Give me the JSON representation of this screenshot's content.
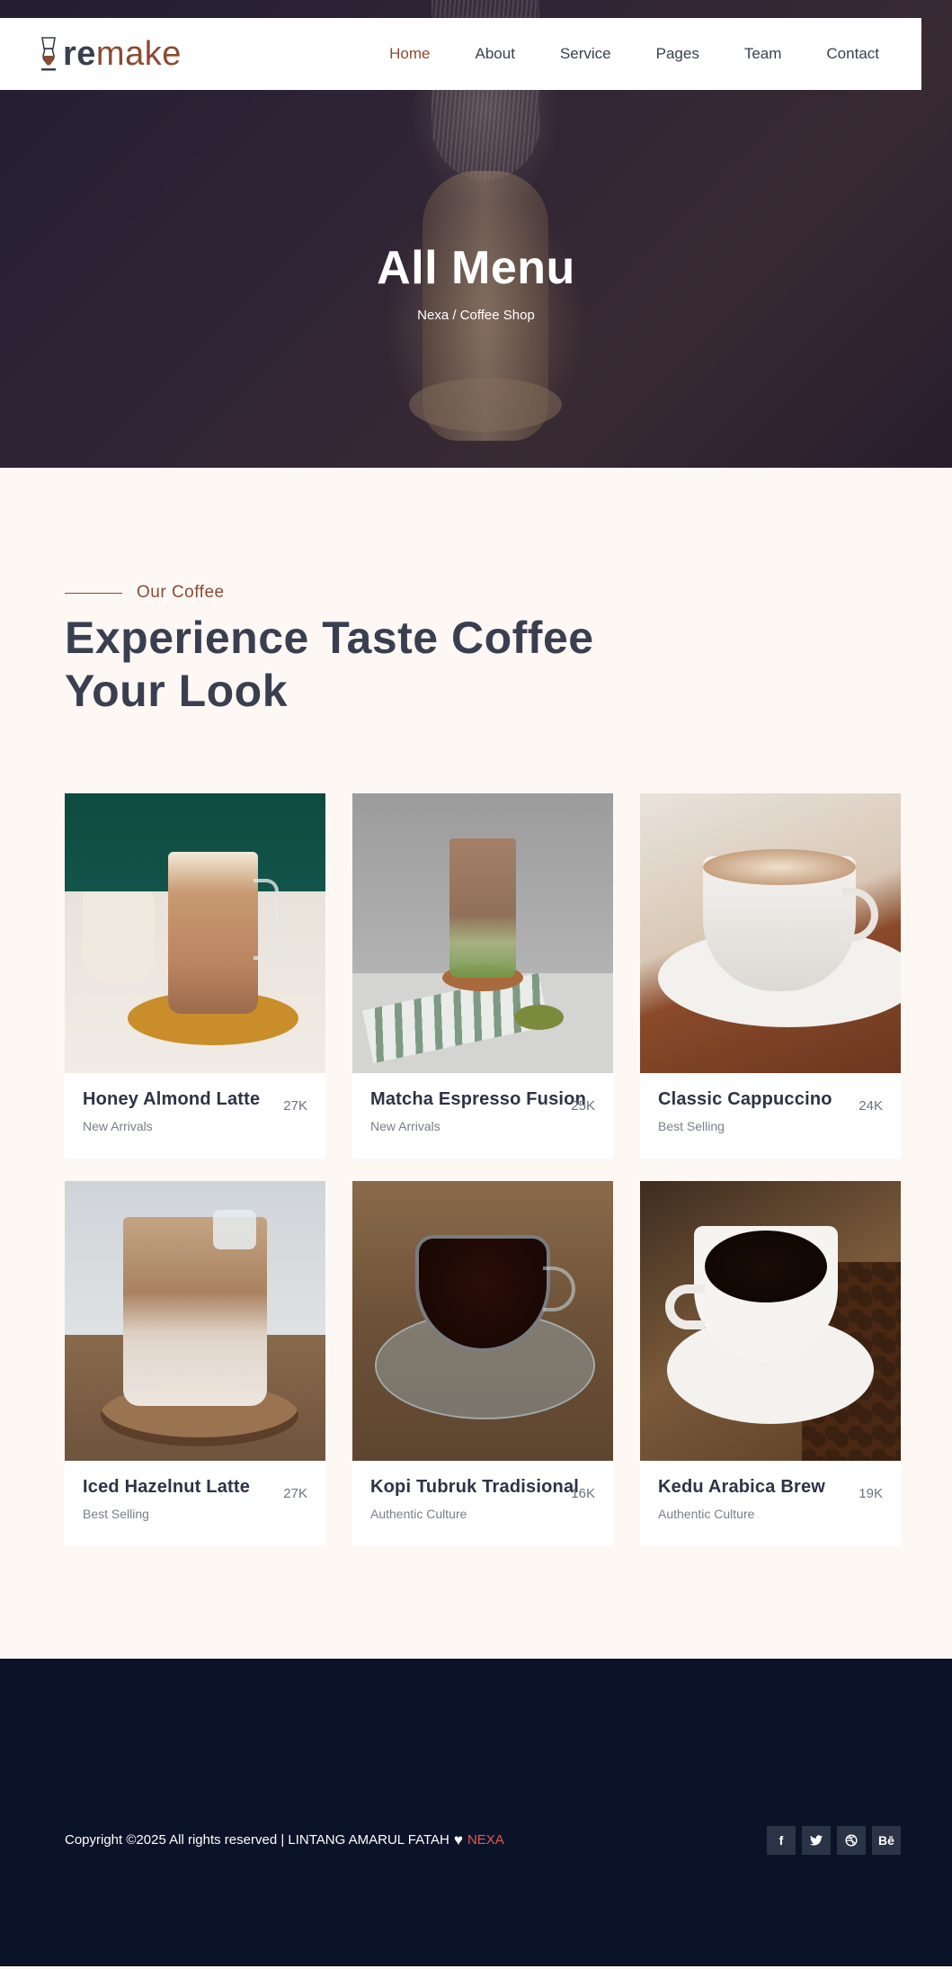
{
  "brand": {
    "logo_prefix": "re",
    "logo_suffix": "make",
    "accent": "#8b4a32"
  },
  "nav": {
    "items": [
      {
        "label": "Home",
        "active": true
      },
      {
        "label": "About"
      },
      {
        "label": "Service"
      },
      {
        "label": "Pages"
      },
      {
        "label": "Team"
      },
      {
        "label": "Contact"
      }
    ]
  },
  "hero": {
    "title": "All Menu",
    "breadcrumb": "Nexa / Coffee Shop"
  },
  "section": {
    "eyebrow": "Our Coffee",
    "title_line1": "Experience Taste Coffee",
    "title_line2": "Your Look"
  },
  "products": [
    {
      "name": "Honey Almond Latte",
      "tag": "New Arrivals",
      "price": "27K"
    },
    {
      "name": "Matcha Espresso Fusion",
      "tag": "New Arrivals",
      "price": "25K"
    },
    {
      "name": "Classic Cappuccino",
      "tag": "Best Selling",
      "price": "24K"
    },
    {
      "name": "Iced Hazelnut Latte",
      "tag": "Best Selling",
      "price": "27K"
    },
    {
      "name": "Kopi Tubruk Tradisional",
      "tag": "Authentic Culture",
      "price": "16K"
    },
    {
      "name": "Kedu Arabica Brew",
      "tag": "Authentic Culture",
      "price": "19K"
    }
  ],
  "footer": {
    "copyright": "Copyright ©2025 All rights reserved | LINTANG AMARUL FATAH",
    "brand_link": "NEXA",
    "socials": [
      {
        "icon": "facebook-icon",
        "glyph": "f"
      },
      {
        "icon": "twitter-icon",
        "glyph": "🐦"
      },
      {
        "icon": "dribbble-icon",
        "glyph": "◎"
      },
      {
        "icon": "behance-icon",
        "glyph": "Bē"
      }
    ]
  }
}
